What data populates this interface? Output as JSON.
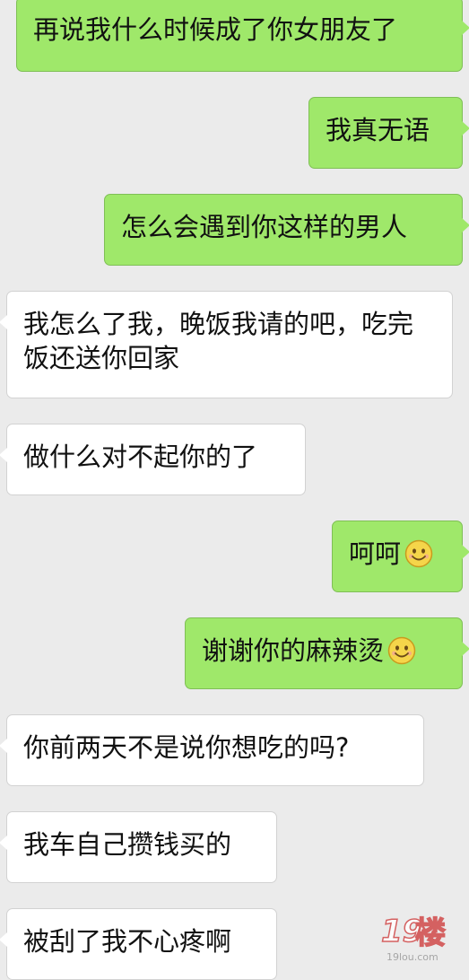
{
  "messages": [
    {
      "side": "out",
      "text": "再说我什么时候成了你女朋友了"
    },
    {
      "side": "out",
      "text": "我真无语"
    },
    {
      "side": "out",
      "text": "怎么会遇到你这样的男人"
    },
    {
      "side": "in",
      "text": "我怎么了我，晚饭我请的吧，吃完饭还送你回家"
    },
    {
      "side": "in",
      "text": "做什么对不起你的了"
    },
    {
      "side": "out",
      "text": "呵呵",
      "emoji": "smile-emoji"
    },
    {
      "side": "out",
      "text": "谢谢你的麻辣烫",
      "emoji": "smile-emoji"
    },
    {
      "side": "in",
      "text": "你前两天不是说你想吃的吗?"
    },
    {
      "side": "in",
      "text": "我车自己攒钱买的"
    },
    {
      "side": "in",
      "text": "被刮了我不心疼啊"
    }
  ],
  "watermark": {
    "number": "19",
    "char": "楼",
    "url": "19lou.com"
  },
  "colors": {
    "background": "#ebebeb",
    "outgoing_bubble": "#9fe86a",
    "incoming_bubble": "#ffffff"
  }
}
